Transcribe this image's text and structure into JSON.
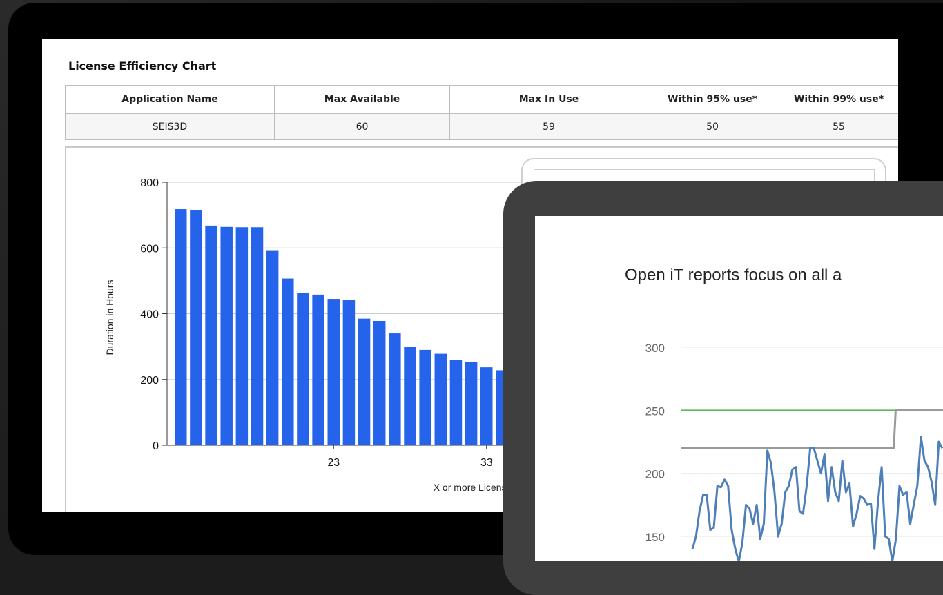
{
  "report": {
    "title": "License Efficiency Chart",
    "columns": [
      "Application Name",
      "Max Available",
      "Max In Use",
      "Within 95% use*",
      "Within 99% use*"
    ],
    "row": [
      "SEIS3D",
      "60",
      "59",
      "50",
      "55"
    ]
  },
  "front": {
    "title": "Open iT reports focus on all a"
  },
  "colors": {
    "bar": "#2563eb",
    "line_blue": "#4f7fb8",
    "line_green": "#5cb85c",
    "line_gray": "#9a9a9a"
  },
  "chart_data": [
    {
      "type": "bar",
      "ylabel": "Duration in Hours",
      "xlabel": "X or more Licenses",
      "ylim": [
        0,
        800
      ],
      "yticks": [
        0,
        200,
        400,
        600,
        800
      ],
      "xticks_labeled": [
        23,
        33
      ],
      "x": [
        13,
        14,
        15,
        16,
        17,
        18,
        19,
        20,
        21,
        22,
        23,
        24,
        25,
        26,
        27,
        28,
        29,
        30,
        31,
        32,
        33,
        34
      ],
      "values": [
        718,
        716,
        668,
        664,
        663,
        663,
        593,
        507,
        462,
        458,
        445,
        442,
        385,
        378,
        340,
        300,
        290,
        278,
        260,
        253,
        237,
        228
      ],
      "grid": true
    },
    {
      "type": "line",
      "yticks": [
        150,
        200,
        250,
        300
      ],
      "ylim": [
        140,
        310
      ],
      "series": [
        {
          "color": "green",
          "values": [
            250,
            250,
            250,
            250,
            250,
            250,
            250,
            250,
            250,
            250,
            250,
            250,
            250,
            250,
            250,
            250,
            250,
            250,
            250,
            250,
            250,
            250,
            250,
            250,
            250,
            250,
            250,
            250,
            250,
            250,
            250,
            250,
            250,
            250,
            250,
            250,
            250,
            250,
            250,
            250,
            250,
            250,
            250,
            250,
            250,
            250,
            250,
            250,
            250,
            250,
            250,
            250,
            250,
            250,
            250,
            250,
            250,
            250,
            250,
            250,
            250,
            250,
            250,
            250,
            250,
            250,
            250,
            250,
            250,
            250,
            250,
            250,
            250,
            250,
            250,
            250,
            250,
            250,
            250,
            250,
            250,
            250,
            250,
            250,
            250,
            250,
            250,
            250,
            250,
            250,
            250,
            250,
            250,
            250,
            250,
            250,
            250,
            250,
            250,
            250,
            250,
            250,
            250,
            250,
            250,
            250,
            250,
            250,
            250,
            250,
            250,
            250,
            250,
            250,
            250,
            250,
            250,
            250,
            250,
            250,
            250,
            250,
            250,
            250,
            250,
            250,
            250,
            250,
            250,
            250,
            250,
            250,
            250,
            250,
            250,
            250,
            250,
            250,
            250,
            250,
            250,
            250,
            250,
            250,
            250,
            250
          ]
        },
        {
          "color": "gray",
          "values": [
            220,
            220,
            220,
            220,
            220,
            220,
            220,
            220,
            220,
            220,
            220,
            220,
            220,
            220,
            220,
            220,
            220,
            220,
            220,
            220,
            220,
            220,
            220,
            220,
            220,
            220,
            220,
            220,
            220,
            220,
            220,
            220,
            220,
            220,
            220,
            220,
            220,
            220,
            220,
            220,
            220,
            220,
            220,
            220,
            220,
            220,
            220,
            220,
            220,
            220,
            220,
            220,
            220,
            220,
            220,
            220,
            220,
            220,
            220,
            220,
            220,
            220,
            220,
            220,
            220,
            220,
            220,
            220,
            220,
            220,
            220,
            220,
            220,
            220,
            220,
            220,
            220,
            220,
            220,
            220,
            220,
            220,
            220,
            220,
            220,
            220,
            220,
            220,
            220,
            220,
            220,
            220,
            220,
            220,
            220,
            220,
            220,
            220,
            220,
            220,
            220,
            220,
            220,
            220,
            220,
            220,
            220,
            220,
            220,
            220,
            220,
            220,
            220,
            220,
            220,
            220,
            250,
            250,
            250,
            250,
            250,
            250,
            250,
            250,
            250,
            250,
            250,
            250,
            250,
            250,
            250,
            250,
            250,
            250,
            250,
            250,
            250,
            250,
            250,
            250,
            250,
            250,
            250,
            250,
            250,
            250
          ]
        },
        {
          "color": "blue",
          "values": [
            140,
            150,
            170,
            183,
            183,
            155,
            157,
            190,
            189,
            195,
            190,
            155,
            140,
            130,
            145,
            175,
            172,
            160,
            175,
            148,
            160,
            218,
            208,
            185,
            150,
            160,
            185,
            190,
            203,
            205,
            170,
            168,
            190,
            220,
            220,
            210,
            200,
            215,
            178,
            205,
            185,
            178,
            210,
            185,
            192,
            158,
            168,
            182,
            180,
            175,
            176,
            140,
            178,
            205,
            150,
            148,
            130,
            148,
            190,
            183,
            185,
            160,
            175,
            190,
            229,
            210,
            205,
            193,
            175,
            225,
            220
          ]
        }
      ]
    }
  ]
}
